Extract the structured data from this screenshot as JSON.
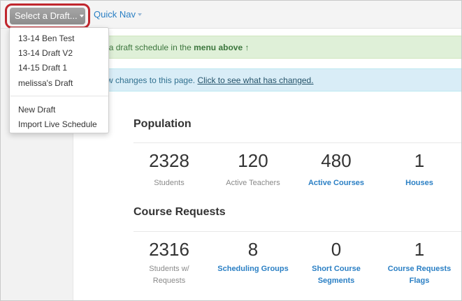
{
  "nav": {
    "select_draft_label": "Select a Draft...",
    "quick_nav_label": "Quick Nav"
  },
  "dropdown": {
    "items": [
      "13-14 Ben Test",
      "13-14 Draft V2",
      "14-15 Draft 1",
      "melissa's Draft"
    ],
    "actions": [
      "New Draft",
      "Import Live Schedule"
    ]
  },
  "alerts": {
    "select_prefix": "se select a draft schedule in the ",
    "select_bold": "menu above",
    "select_arrow": "↑",
    "changes_prefix": "re are new changes to this page. ",
    "changes_link": "Click to see what has changed."
  },
  "population": {
    "title": "Population",
    "stats": [
      {
        "value": "2328",
        "label": "Students"
      },
      {
        "value": "120",
        "label": "Active Teachers"
      },
      {
        "value": "480",
        "label": "Active Courses"
      },
      {
        "value": "1",
        "label": "Houses"
      }
    ]
  },
  "course_requests": {
    "title": "Course Requests",
    "stats": [
      {
        "value": "2316",
        "label_line1": "Students w/",
        "label_line2": "Requests"
      },
      {
        "value": "8",
        "label_line1": "Scheduling Groups",
        "label_line2": ""
      },
      {
        "value": "0",
        "label_line1": "Short Course",
        "label_line2": "Segments"
      },
      {
        "value": "1",
        "label_line1": "Course Requests",
        "label_line2": "Flags"
      }
    ]
  },
  "colors": {
    "highlight_ring": "#c0262d",
    "link": "#2a7fc4",
    "success_bg": "#dff0d8",
    "info_bg": "#d9edf7"
  }
}
